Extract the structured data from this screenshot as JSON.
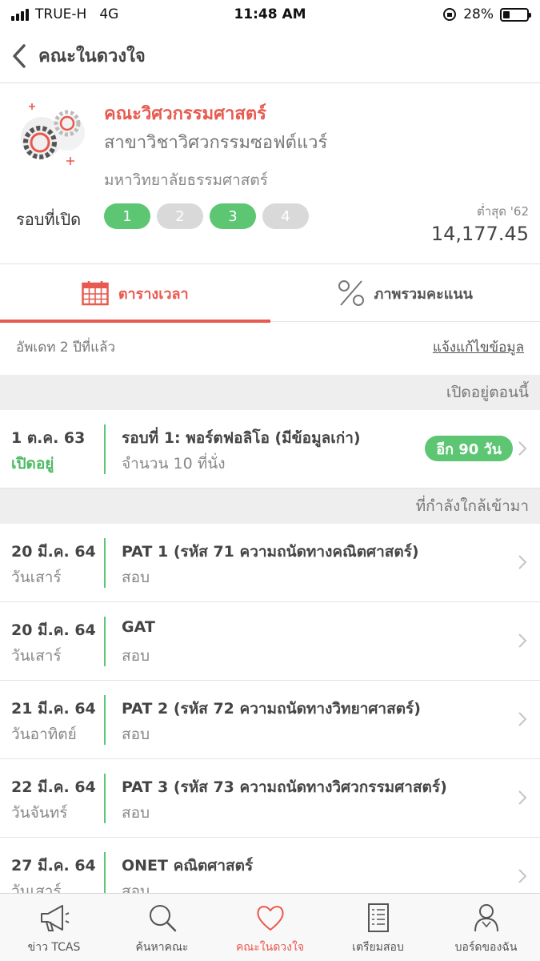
{
  "status_bar": {
    "carrier": "TRUE-H",
    "network": "4G",
    "time": "11:48 AM",
    "battery": "28%",
    "battery_level": 0.28
  },
  "nav": {
    "title": "คณะในดวงใจ"
  },
  "header": {
    "faculty": "คณะวิศวกรรมศาสตร์",
    "branch": "สาขาวิชาวิศวกรรมซอฟต์แวร์",
    "university": "มหาวิทยาลัยธรรมศาสตร์",
    "rounds_label": "รอบที่เปิด",
    "rounds": [
      {
        "label": "1",
        "open": true
      },
      {
        "label": "2",
        "open": false
      },
      {
        "label": "3",
        "open": true
      },
      {
        "label": "4",
        "open": false
      }
    ],
    "min_score_label": "ต่ำสุด '62",
    "min_score": "14,177.45"
  },
  "tabs": [
    {
      "label": "ตารางเวลา",
      "icon": "calendar-icon",
      "active": true
    },
    {
      "label": "ภาพรวมคะแนน",
      "icon": "percent-icon",
      "active": false
    }
  ],
  "update": {
    "text": "อัพเดท 2 ปีที่แล้ว",
    "report_link": "แจ้งแก้ไขข้อมูล"
  },
  "sections": {
    "open_now": "เปิดอยู่ตอนนี้",
    "upcoming": "ที่กำลังใกล้เข้ามา"
  },
  "open_items": [
    {
      "date": "1 ต.ค. 63",
      "status": "เปิดอยู่",
      "title": "รอบที่ 1: พอร์ตฟอลิโอ (มีข้อมูลเก่า)",
      "sub": "จำนวน 10 ที่นั่ง",
      "badge": "อีก 90 วัน"
    }
  ],
  "upcoming_items": [
    {
      "date": "20 มี.ค. 64",
      "day": "วันเสาร์",
      "title": "PAT 1  (รหัส 71 ความถนัดทางคณิตศาสตร์)",
      "sub": "สอบ"
    },
    {
      "date": "20 มี.ค. 64",
      "day": "วันเสาร์",
      "title": "GAT",
      "sub": "สอบ"
    },
    {
      "date": "21 มี.ค. 64",
      "day": "วันอาทิตย์",
      "title": "PAT 2 (รหัส 72 ความถนัดทางวิทยาศาสตร์)",
      "sub": "สอบ"
    },
    {
      "date": "22 มี.ค. 64",
      "day": "วันจันทร์",
      "title": "PAT 3  (รหัส 73 ความถนัดทางวิศวกรรมศาสตร์)",
      "sub": "สอบ"
    },
    {
      "date": "27 มี.ค. 64",
      "day": "วันเสาร์",
      "title": "ONET คณิตศาสตร์",
      "sub": "สอบ"
    }
  ],
  "tabbar": [
    {
      "label": "ข่าว TCAS",
      "icon": "megaphone-icon",
      "active": false
    },
    {
      "label": "ค้นหาคณะ",
      "icon": "search-icon",
      "active": false
    },
    {
      "label": "คณะในดวงใจ",
      "icon": "heart-icon",
      "active": true
    },
    {
      "label": "เตรียมสอบ",
      "icon": "checklist-icon",
      "active": false
    },
    {
      "label": "บอร์ดของฉัน",
      "icon": "user-icon",
      "active": false
    }
  ],
  "colors": {
    "accent": "#e8594f",
    "green": "#5cc673",
    "grey_pill": "#d9d9d9"
  }
}
